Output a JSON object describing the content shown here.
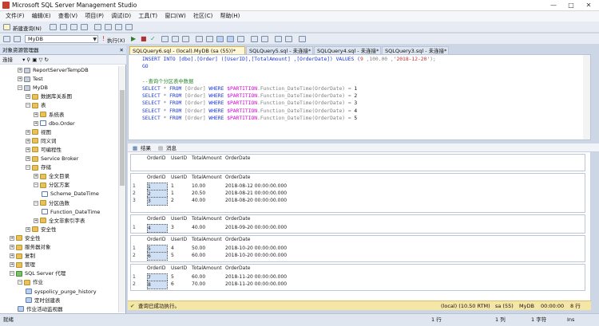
{
  "window": {
    "title": "Microsoft SQL Server Management Studio"
  },
  "menu": [
    "文件(F)",
    "编辑(E)",
    "查看(V)",
    "项目(P)",
    "调试(D)",
    "工具(T)",
    "窗口(W)",
    "社区(C)",
    "帮助(H)"
  ],
  "toolbar": {
    "new_query": "新建查询(N)",
    "database": "MyDB",
    "execute": "执行(X)"
  },
  "object_explorer": {
    "title": "对象资源管理器",
    "connect": "连接",
    "nodes": [
      {
        "label": "ReportServerTempDB",
        "icon": "database-icon"
      },
      {
        "label": "Test",
        "icon": "database-icon"
      },
      {
        "label": "MyDB",
        "icon": "database-icon"
      },
      {
        "label": "数据库关系图",
        "icon": "folder-icon"
      },
      {
        "label": "表",
        "icon": "folder-icon"
      },
      {
        "label": "系统表",
        "icon": "folder-icon"
      },
      {
        "label": "dbo.Order",
        "icon": "table-icon"
      },
      {
        "label": "视图",
        "icon": "folder-icon"
      },
      {
        "label": "同义词",
        "icon": "folder-icon"
      },
      {
        "label": "可编程性",
        "icon": "folder-icon"
      },
      {
        "label": "Service Broker",
        "icon": "folder-icon"
      },
      {
        "label": "存储",
        "icon": "folder-icon"
      },
      {
        "label": "全文目录",
        "icon": "folder-icon"
      },
      {
        "label": "分区方案",
        "icon": "folder-icon"
      },
      {
        "label": "Scheme_DateTime",
        "icon": "scheme-icon"
      },
      {
        "label": "分区函数",
        "icon": "folder-icon"
      },
      {
        "label": "Function_DateTime",
        "icon": "function-icon"
      },
      {
        "label": "全文非索引字表",
        "icon": "folder-icon"
      },
      {
        "label": "安全性",
        "icon": "folder-icon"
      },
      {
        "label": "安全性",
        "icon": "folder-icon"
      },
      {
        "label": "服务器对象",
        "icon": "folder-icon"
      },
      {
        "label": "复制",
        "icon": "folder-icon"
      },
      {
        "label": "管理",
        "icon": "folder-icon"
      },
      {
        "label": "SQL Server 代理",
        "icon": "agent-icon"
      },
      {
        "label": "作业",
        "icon": "folder-icon"
      },
      {
        "label": "syspolicy_purge_history",
        "icon": "job-icon"
      },
      {
        "label": "定时创建表",
        "icon": "job-icon"
      },
      {
        "label": "作业活动监视器",
        "icon": "monitor-icon"
      }
    ]
  },
  "tabs": [
    {
      "label": "SQLQuery6.sql - (local).MyDB (sa (55))*",
      "active": true
    },
    {
      "label": "SQLQuery5.sql - 未连接*"
    },
    {
      "label": "SQLQuery4.sql - 未连接*"
    },
    {
      "label": "SQLQuery3.sql - 未连接*"
    }
  ],
  "editor": {
    "line1_a": "INSERT INTO [dbo].[Order] ([UserID],[TotalAmount] ,[OrderDate]) VALUES (",
    "line1_b": "9",
    "line1_c": " ,100.00 ,",
    "line1_d": "'2018-12-20'",
    "line1_e": ");",
    "line2": "GO",
    "comment": "--查询个分区表中数据",
    "select_lines": [
      {
        "num": "1"
      },
      {
        "num": "2"
      },
      {
        "num": "3"
      },
      {
        "num": "4"
      },
      {
        "num": "5"
      }
    ],
    "kw_select": "SELECT",
    "star": " * ",
    "kw_from": "FROM",
    "table": " [Order] ",
    "kw_where": "WHERE",
    "func": " $PARTITION",
    "func_rest": ".Function_DateTime(OrderDate) = "
  },
  "result_tabs": {
    "results": "结果",
    "messages": "消息"
  },
  "result_columns": [
    "OrderID",
    "UserID",
    "TotalAmount",
    "OrderDate"
  ],
  "result_sets": [
    {
      "rows": []
    },
    {
      "rows": [
        [
          "1",
          "1",
          "10.00",
          "2018-08-12 00:00:00.000"
        ],
        [
          "2",
          "1",
          "20.50",
          "2018-08-21 00:00:00.000"
        ],
        [
          "3",
          "2",
          "40.00",
          "2018-08-20 00:00:00.000"
        ]
      ]
    },
    {
      "rows": [
        [
          "4",
          "3",
          "40.00",
          "2018-09-20 00:00:00.000"
        ]
      ]
    },
    {
      "rows": [
        [
          "5",
          "4",
          "50.00",
          "2018-10-20 00:00:00.000"
        ],
        [
          "6",
          "5",
          "60.00",
          "2018-10-20 00:00:00.000"
        ]
      ]
    },
    {
      "rows": [
        [
          "7",
          "5",
          "60.00",
          "2018-11-20 00:00:00.000"
        ],
        [
          "8",
          "6",
          "70.00",
          "2018-11-20 00:00:00.000"
        ]
      ]
    }
  ],
  "status": {
    "message": "查询已成功执行。",
    "server": "(local) (10.50 RTM)",
    "user": "sa (55)",
    "db": "MyDB",
    "time": "00:00:00",
    "rows": "8 行"
  },
  "bottom": {
    "ready": "就绪",
    "ln": "1 行",
    "col": "1 列",
    "ch": "1 字符",
    "ins": "Ins"
  }
}
